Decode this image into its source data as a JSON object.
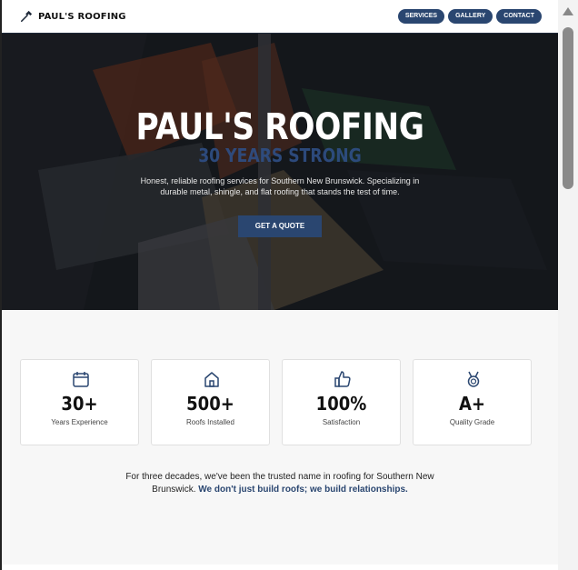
{
  "header": {
    "brand": "PAUL'S ROOFING",
    "nav": [
      "SERVICES",
      "GALLERY",
      "CONTACT"
    ]
  },
  "hero": {
    "title": "PAUL'S ROOFING",
    "subtitle": "30 YEARS STRONG",
    "description": "Honest, reliable roofing services for Southern New Brunswick. Specializing in durable metal, shingle, and flat roofing that stands the test of time.",
    "cta": "GET A QUOTE"
  },
  "stats": [
    {
      "icon": "calendar-icon",
      "value": "30+",
      "label": "Years Experience"
    },
    {
      "icon": "home-icon",
      "value": "500+",
      "label": "Roofs Installed"
    },
    {
      "icon": "thumbs-up-icon",
      "value": "100%",
      "label": "Satisfaction"
    },
    {
      "icon": "medal-icon",
      "value": "A+",
      "label": "Quality Grade"
    }
  ],
  "tagline": {
    "plain": "For three decades, we've been the trusted name in roofing for Southern New Brunswick. ",
    "emphasis": "We don't just build roofs; we build relationships."
  },
  "colors": {
    "accent": "#2a4670",
    "hero_overlay": "#0a0c10"
  }
}
